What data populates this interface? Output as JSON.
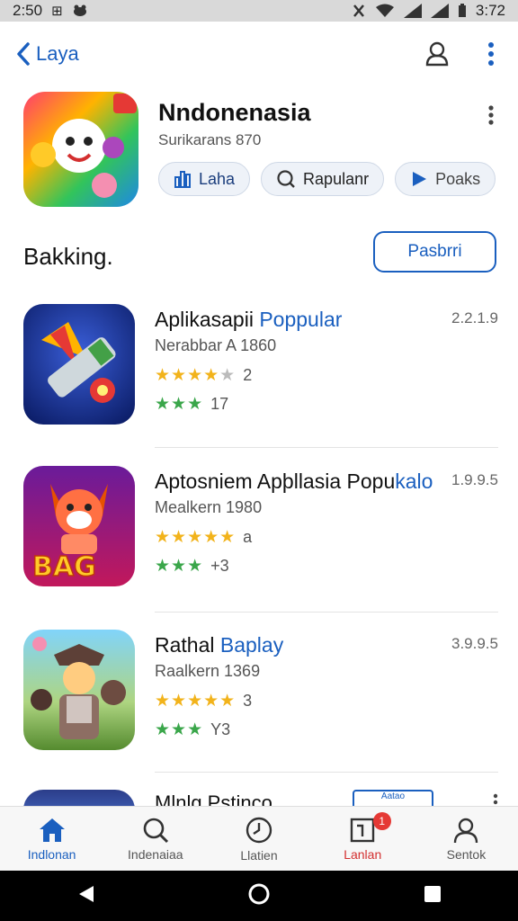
{
  "status_bar": {
    "time": "2:50",
    "left_glyph": "⊞",
    "right_time": "3:72",
    "icons": [
      "notification-icon",
      "vibrate-icon",
      "wifi-icon",
      "signal-icon",
      "signal-icon",
      "battery-icon"
    ]
  },
  "top_bar": {
    "back_label": "Laya",
    "icons": [
      "back-chevron-icon",
      "account-icon",
      "more-vert-icon"
    ],
    "accent": "#1a5fbf"
  },
  "featured": {
    "title": "Nndonenasia",
    "subtitle": "Surikarans 870",
    "chips": [
      {
        "label": "Laha",
        "icon": "bar-chart-icon"
      },
      {
        "label": "Rapulanr",
        "icon": "search-icon"
      },
      {
        "label": "Poaks",
        "icon": "play-icon"
      }
    ]
  },
  "section": {
    "title": "Bakking.",
    "button_label": "Pasbrri"
  },
  "apps": [
    {
      "name_plain": "Aplikasapii ",
      "name_highlight": "Poppular",
      "developer": "Nerabbar A 1860",
      "size": "2.2.1.9",
      "rating_stars": "★★★★",
      "rating_dim": "★",
      "rating_count": "2",
      "green_stars": "★★★",
      "green_count": "17"
    },
    {
      "name_plain": "Aptosniem Apþllasia Popu",
      "name_highlight": "kalo",
      "developer": "Mealkern 1980",
      "size": "1.9.9.5",
      "rating_stars": "★★★★★",
      "rating_dim": "",
      "rating_count": "a",
      "green_stars": "★★★",
      "green_count": "+3"
    },
    {
      "name_plain": "Rathal ",
      "name_highlight": "Baplay",
      "developer": "Raalkern 1369",
      "size": "3.9.9.5",
      "rating_stars": "★★★★★",
      "rating_dim": "",
      "rating_count": "3",
      "green_stars": "★★★",
      "green_count": "Y3"
    }
  ],
  "partial_app": {
    "name": "Mlnlg Pstinco",
    "badge": "Aatao"
  },
  "bottom_nav": [
    {
      "label": "Indlonan",
      "icon": "home-icon",
      "active": true
    },
    {
      "label": "Indenaiaa",
      "icon": "search-icon"
    },
    {
      "label": "Llatien",
      "icon": "clock-icon"
    },
    {
      "label": "Lanlan",
      "icon": "apps-icon",
      "badge": "1"
    },
    {
      "label": "Sentok",
      "icon": "person-icon"
    }
  ]
}
